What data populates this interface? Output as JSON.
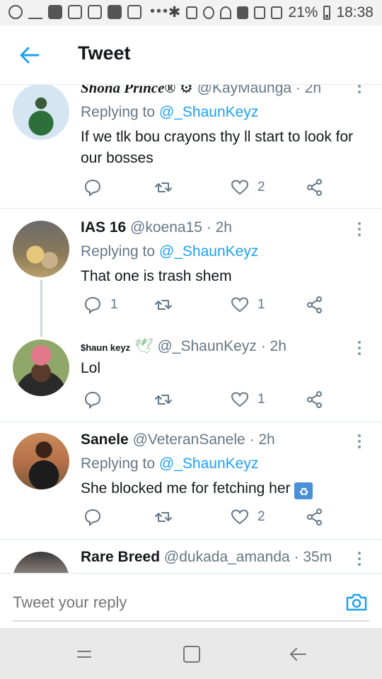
{
  "status_bar": {
    "battery": "21%",
    "time": "18:38",
    "left_icons": [
      "whatsapp-icon",
      "upload-icon",
      "message-icon",
      "instagram-icon",
      "gmail-icon",
      "news-icon",
      "gmail-icon"
    ],
    "dots": "•••",
    "right_icons": [
      "bluetooth-icon",
      "mute-icon",
      "alarm-icon",
      "wifi-icon",
      "sim-icon",
      "signal-icon",
      "signal-icon",
      "battery-icon"
    ]
  },
  "header": {
    "title": "Tweet"
  },
  "tweets": [
    {
      "name": "Shona Prince®",
      "handle": "@KayMaunga",
      "time": "· 2h",
      "replying_prefix": "Replying to",
      "replying_handle": "@_ShaunKeyz",
      "text": "If we tlk bou crayons thy ll start to look for our bosses",
      "likes": "2",
      "retweets": "",
      "replies": ""
    },
    {
      "name": "IAS 16",
      "handle": "@koena15",
      "time": "· 2h",
      "replying_prefix": "Replying to",
      "replying_handle": "@_ShaunKeyz",
      "text": "That one is trash shem",
      "replies": "1",
      "likes": "1",
      "retweets": ""
    },
    {
      "name": "$haun keyz",
      "handle": "@_ShaunKeyz",
      "time": "· 2h",
      "text": "Lol",
      "likes": "1",
      "retweets": "",
      "replies": ""
    },
    {
      "name": "Sanele",
      "handle": "@VeteranSanele",
      "time": "· 2h",
      "replying_prefix": "Replying to",
      "replying_handle": "@_ShaunKeyz",
      "text": "She blocked me for fetching her",
      "likes": "2",
      "retweets": "",
      "replies": ""
    },
    {
      "name": "Rare Breed",
      "handle": "@dukada_amanda",
      "time": "· 35m"
    }
  ],
  "reply_bar": {
    "placeholder": "Tweet your reply"
  },
  "colors": {
    "accent": "#1da1f2",
    "muted": "#657786",
    "text": "#14171a"
  }
}
